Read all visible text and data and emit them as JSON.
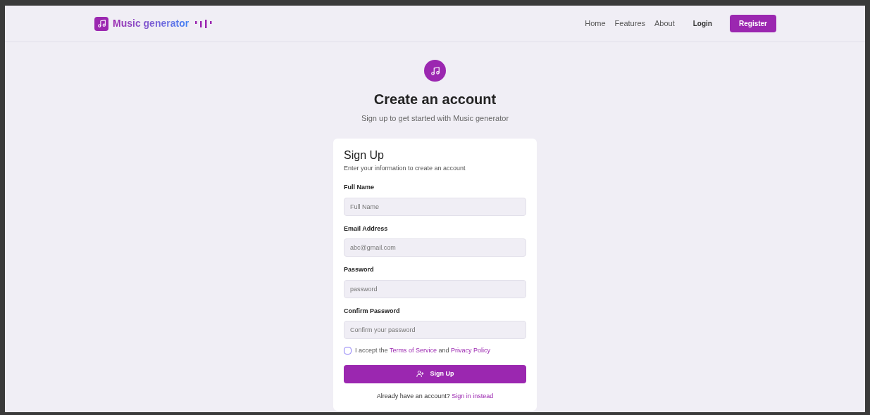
{
  "brand": {
    "name": "Music generator"
  },
  "nav": {
    "links": [
      "Home",
      "Features",
      "About"
    ],
    "login": "Login",
    "register": "Register"
  },
  "hero": {
    "title": "Create an account",
    "subtitle": "Sign up to get started with Music generator"
  },
  "card": {
    "title": "Sign Up",
    "description": "Enter your information to create an account",
    "fields": [
      {
        "label": "Full Name",
        "placeholder": "Full Name"
      },
      {
        "label": "Email Address",
        "placeholder": "abc@gmail.com"
      },
      {
        "label": "Password",
        "placeholder": "password"
      },
      {
        "label": "Confirm Password",
        "placeholder": "Confirm your password"
      }
    ],
    "terms": {
      "checked": false,
      "prefix": "I accept the",
      "link1": "Terms of Service",
      "joiner": "and",
      "link2": "Privacy Policy"
    },
    "submit": "Sign Up",
    "footer": {
      "question": "Already have an account?",
      "link": "Sign in instead"
    }
  }
}
